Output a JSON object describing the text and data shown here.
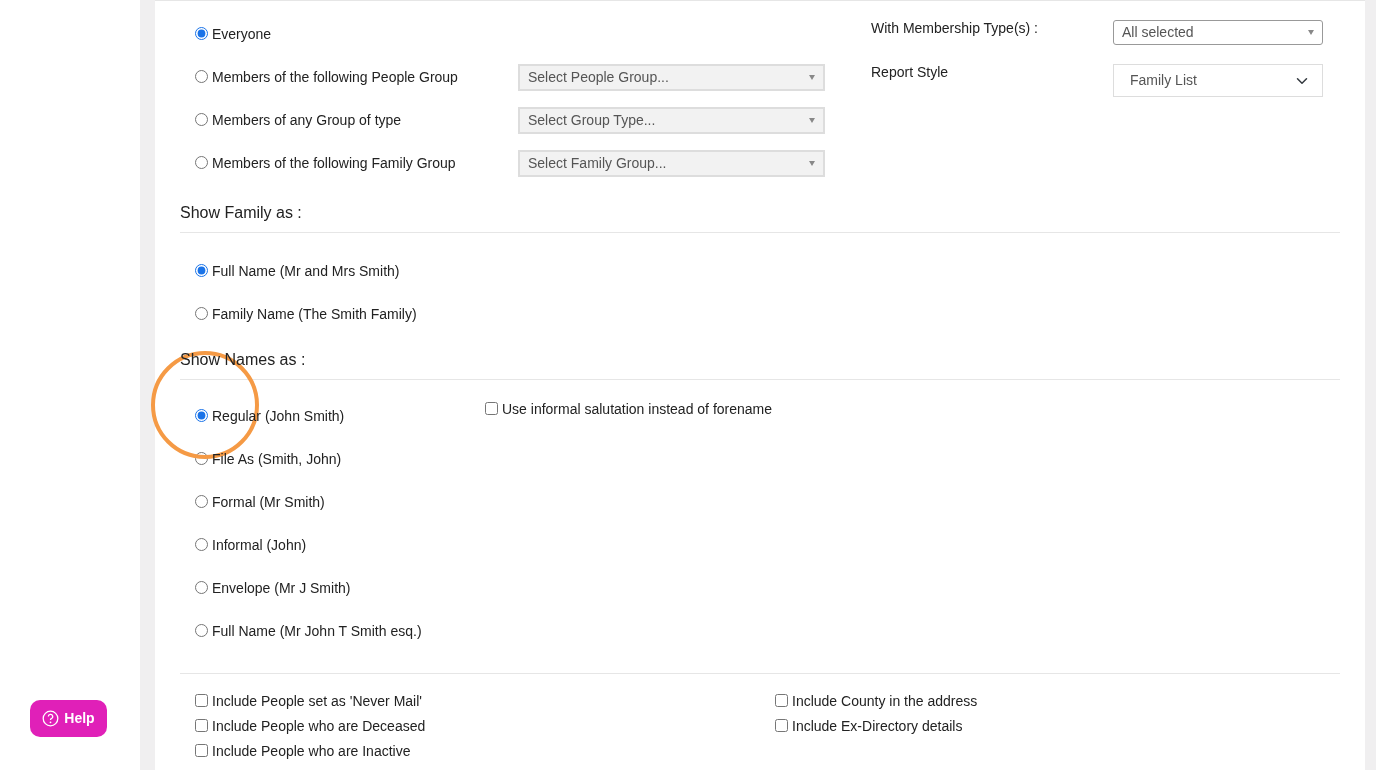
{
  "audience": {
    "options": [
      {
        "label": "Everyone",
        "selected": true
      },
      {
        "label": "Members of the following People Group",
        "selected": false,
        "select_placeholder": "Select People Group..."
      },
      {
        "label": "Members of any Group of type",
        "selected": false,
        "select_placeholder": "Select Group Type..."
      },
      {
        "label": "Members of the following Family Group",
        "selected": false,
        "select_placeholder": "Select Family Group..."
      }
    ]
  },
  "membership": {
    "label": "With Membership Type(s) :",
    "value": "All selected"
  },
  "report_style": {
    "label": "Report Style",
    "value": "Family List"
  },
  "show_family": {
    "title": "Show Family as :",
    "options": [
      {
        "label": "Full Name (Mr and Mrs Smith)",
        "selected": true
      },
      {
        "label": "Family Name (The Smith Family)",
        "selected": false
      }
    ]
  },
  "show_names": {
    "title": "Show Names as :",
    "options": [
      {
        "label": "Regular (John Smith)",
        "selected": true
      },
      {
        "label": "File As (Smith, John)",
        "selected": false
      },
      {
        "label": "Formal (Mr Smith)",
        "selected": false
      },
      {
        "label": "Informal (John)",
        "selected": false
      },
      {
        "label": "Envelope (Mr J Smith)",
        "selected": false
      },
      {
        "label": "Full Name (Mr John T Smith esq.)",
        "selected": false
      }
    ],
    "informal_salutation": {
      "label": "Use informal salutation instead of forename",
      "checked": false
    }
  },
  "include_left": [
    {
      "label": "Include People set as 'Never Mail'",
      "checked": false
    },
    {
      "label": "Include People who are Deceased",
      "checked": false
    },
    {
      "label": "Include People who are Inactive",
      "checked": false
    }
  ],
  "include_right": [
    {
      "label": "Include County in the address",
      "checked": false
    },
    {
      "label": "Include Ex-Directory details",
      "checked": false
    }
  ],
  "help_button": {
    "label": "Help"
  }
}
